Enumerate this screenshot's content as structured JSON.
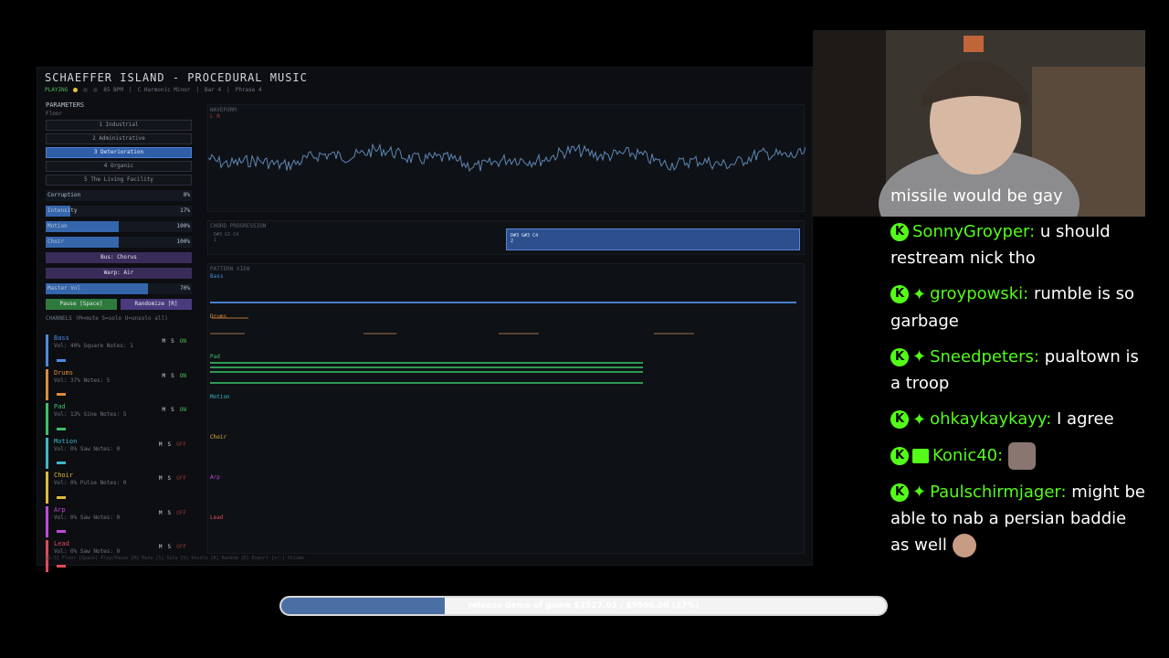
{
  "app": {
    "title": "SCHAEFFER ISLAND - PROCEDURAL MUSIC",
    "state": "PLAYING",
    "tempo": "85 BPM",
    "key": "C Harmonic Minor",
    "bar": "Bar 4",
    "phrase": "Phrase 4"
  },
  "parameters": {
    "title": "PARAMETERS",
    "floor_label": "Floor",
    "floors": [
      "1 Industrial",
      "2 Administrative",
      "3 Deterioration",
      "4 Organic",
      "5 The Living Facility"
    ],
    "active_floor": 2,
    "sliders": [
      {
        "label": "Corruption",
        "value": "0%",
        "level": 0.0
      },
      {
        "label": "Intensity",
        "value": "17%",
        "level": 0.17
      },
      {
        "label": "Motion",
        "value": "100%",
        "level": 0.5
      },
      {
        "label": "Choir",
        "value": "100%",
        "level": 0.5
      }
    ],
    "bus_chorus": "Bus: Chorus",
    "warp_air": "Warp: Air",
    "master": {
      "label": "Master Vol",
      "value": "70%",
      "level": 0.7
    },
    "pause_label": "Pause [Space]",
    "randomize_label": "Randomize [R]"
  },
  "channels": {
    "title": "CHANNELS",
    "hint": "(M=mute S=solo U=unsolo all)",
    "mute_label": "M",
    "solo_label": "S",
    "tracks": [
      {
        "name": "Bass",
        "info": "Vol: 40%  Square  Notes: 1",
        "state": "ON",
        "color": "#4a8be0"
      },
      {
        "name": "Drums",
        "info": "Vol: 37%  Notes: 5",
        "state": "ON",
        "color": "#e08a3a"
      },
      {
        "name": "Pad",
        "info": "Vol: 13%  Sine  Notes: 5",
        "state": "ON",
        "color": "#3fbf6a"
      },
      {
        "name": "Motion",
        "info": "Vol: 0%  Saw  Notes: 0",
        "state": "OFF",
        "color": "#3fb6c9"
      },
      {
        "name": "Choir",
        "info": "Vol: 0%  Pulse  Notes: 0",
        "state": "OFF",
        "color": "#e0b83a"
      },
      {
        "name": "Arp",
        "info": "Vol: 0%  Saw  Notes: 0",
        "state": "OFF",
        "color": "#c04ad8"
      },
      {
        "name": "Lead",
        "info": "Vol: 0%  Saw  Notes: 0",
        "state": "OFF",
        "color": "#e04a5a"
      }
    ]
  },
  "footer": "[1-5] Floor  [Space] Play/Pause  [M] Mute  [S] Solo  [U] Unsolo  [R] Random  [E] Export  [+/-] Volume",
  "waveform": {
    "title": "WAVEFORM",
    "lr": "L R"
  },
  "chords": {
    "title": "CHORD PROGRESSION",
    "items": [
      {
        "label": "D#3 G3 C4",
        "num": "1",
        "active": false
      },
      {
        "label": "D#3 G#3 C4",
        "num": "2",
        "active": true
      }
    ]
  },
  "pattern": {
    "title": "PATTERN VIEW",
    "lanes": [
      {
        "name": "Bass",
        "color": "#4a8be0"
      },
      {
        "name": "Drums",
        "color": "#e08a3a"
      },
      {
        "name": "Pad",
        "color": "#3fbf6a"
      },
      {
        "name": "Motion",
        "color": "#3fb6c9"
      },
      {
        "name": "Choir",
        "color": "#e0b83a"
      },
      {
        "name": "Arp",
        "color": "#c04ad8"
      },
      {
        "name": "Lead",
        "color": "#e04a5a"
      }
    ]
  },
  "chat": {
    "messages": [
      {
        "user": "",
        "text": "missile would be gay",
        "badges": []
      },
      {
        "user": "SonnyGroyper:",
        "text": "u should restream nick tho",
        "badges": [
          "kick"
        ]
      },
      {
        "user": "groypowski:",
        "text": "rumble is so garbage",
        "badges": [
          "kick",
          "star"
        ]
      },
      {
        "user": "Sneedpeters:",
        "text": "pualtown is a troop",
        "badges": [
          "kick",
          "star"
        ]
      },
      {
        "user": "ohkaykaykayy:",
        "text": "I agree",
        "badges": [
          "kick",
          "star"
        ]
      },
      {
        "user": "Konic40:",
        "text": "",
        "badges": [
          "kick",
          "gift"
        ],
        "emote": "seal-emote"
      },
      {
        "user": "Paulschirmjager:",
        "text": "might be able to nab a persian baddie as well",
        "badges": [
          "kick",
          "star"
        ],
        "emote": "face-emote"
      }
    ]
  },
  "goal": {
    "text": "release demo of game $2527.03 / $9500.00 (27%)",
    "progress": 0.27
  }
}
